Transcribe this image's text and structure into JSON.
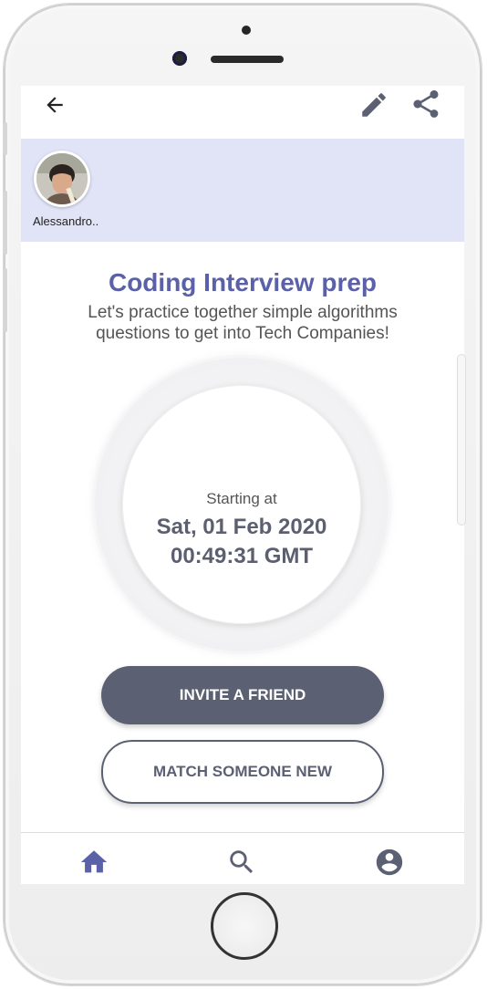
{
  "participants": [
    {
      "name": "Alessandro.."
    }
  ],
  "event": {
    "title": "Coding Interview prep",
    "description": "Let's practice together simple algorithms questions to get into Tech Companies!",
    "starting_label": "Starting at",
    "date": "Sat, 01 Feb 2020",
    "time": "00:49:31 GMT"
  },
  "actions": {
    "invite_label": "INVITE A FRIEND",
    "match_label": "MATCH SOMEONE NEW"
  },
  "icons": {
    "back": "back-arrow-icon",
    "edit": "pencil-icon",
    "share": "share-icon",
    "home": "home-icon",
    "search": "search-icon",
    "account": "account-circle-icon"
  },
  "colors": {
    "accent": "#5b61a8",
    "button_dark": "#5c6073",
    "participants_bg": "#e0e4f6"
  }
}
